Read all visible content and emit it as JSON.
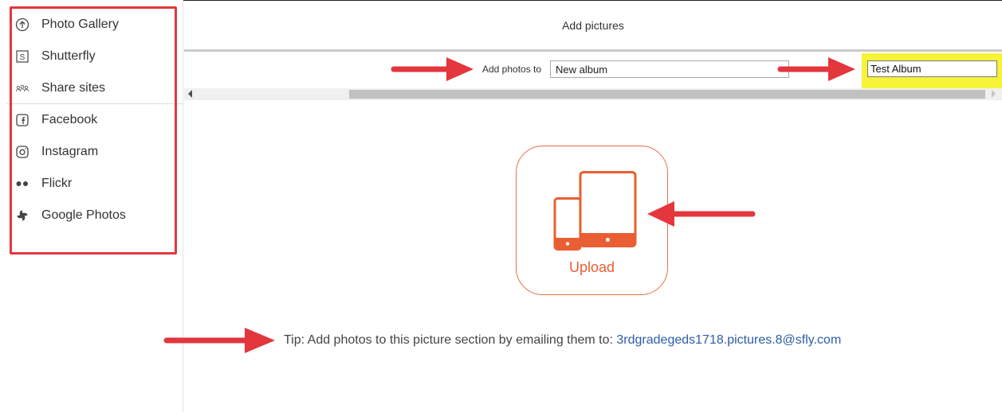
{
  "sidebar": {
    "items": [
      {
        "label": "Photo Gallery",
        "icon": "upload-circle-icon"
      },
      {
        "label": "Shutterfly",
        "icon": "shutterfly-s-icon"
      },
      {
        "label": "Share sites",
        "icon": "people-icon"
      },
      {
        "label": "Facebook",
        "icon": "facebook-icon"
      },
      {
        "label": "Instagram",
        "icon": "instagram-icon"
      },
      {
        "label": "Flickr",
        "icon": "flickr-dots-icon"
      },
      {
        "label": "Google Photos",
        "icon": "pinwheel-icon"
      }
    ]
  },
  "header": {
    "title": "Add pictures"
  },
  "add_photos": {
    "label": "Add photos to",
    "selected_album": "New album",
    "new_album_name": "Test Album"
  },
  "upload": {
    "label": "Upload"
  },
  "tip": {
    "text": "Tip: Add photos to this picture section by emailing them to: ",
    "email": "3rdgradegeds1718.pictures.8@sfly.com"
  },
  "colors": {
    "accent_orange": "#ea5e33",
    "annotation_red": "#e3363d",
    "highlight_yellow": "#f6f338",
    "link_blue": "#2d5ca8"
  }
}
